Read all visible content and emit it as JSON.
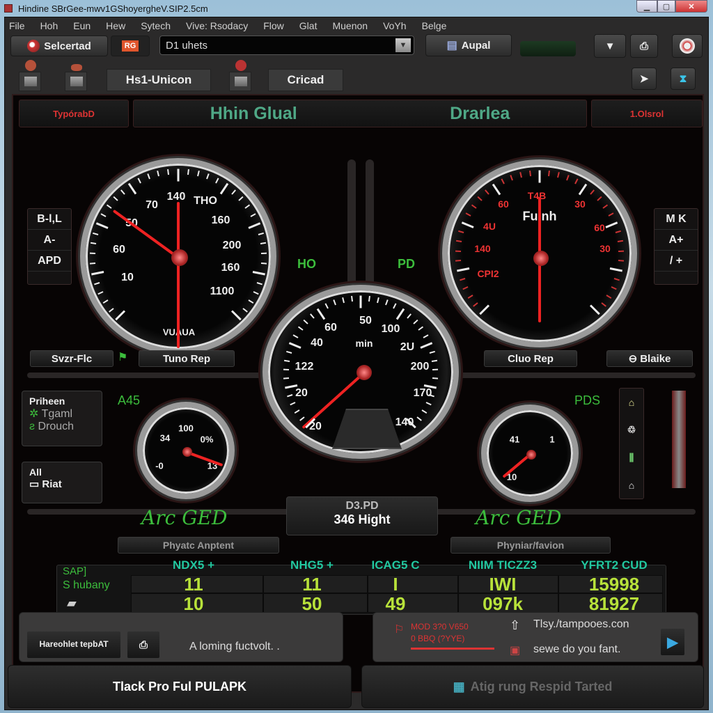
{
  "window": {
    "title": "Hindine SBrGee-mwv1GShoyergheV.SIP2.5cm",
    "controls": [
      "minimize",
      "maximize",
      "close"
    ]
  },
  "menu": [
    "File",
    "Hoh",
    "Eun",
    "Hew",
    "Sytech",
    "Vive: Rsodacy",
    "Flow",
    "Glat",
    "Muenon",
    "VoYh",
    "Belge"
  ],
  "toolbar": {
    "select_label": "Selcertad",
    "badge_label": "RG",
    "search_value": "D1 uhets",
    "apply_label": "Aupal"
  },
  "tabs": [
    {
      "label": "Hs1-Unicon"
    },
    {
      "label": "Cricad"
    }
  ],
  "header": {
    "left": "TypórabD",
    "title_left": "Hhin Glual",
    "title_right": "Drarlea",
    "right": "1.Olsrol"
  },
  "left_side_box": [
    "B-l,L",
    "A-",
    "APD"
  ],
  "right_side_box": [
    "M K",
    "A+",
    "/ +"
  ],
  "gauge_left": {
    "labels": [
      "70",
      "140",
      "THO",
      "50",
      "160",
      "60",
      "200",
      "10",
      "160",
      "1100"
    ],
    "brand": "VUAUA",
    "buttons": [
      "Svzr-Flc",
      "Tuno Rep"
    ]
  },
  "gauge_center": {
    "labels": [
      "60",
      "50",
      "100",
      "40",
      "min",
      "2U",
      "122",
      "200",
      "20",
      "170",
      "20",
      "140"
    ]
  },
  "gauge_right": {
    "labels": [
      "60",
      "T4B",
      "30",
      "4U",
      "Fuinh",
      "60",
      "140",
      "30",
      "CPI2"
    ],
    "buttons": [
      "Cluo Rep",
      "Blaike"
    ]
  },
  "indicators": {
    "left": "HO",
    "right": "PD",
    "small_left": "A45",
    "small_right": "PDS"
  },
  "small_gauge_left": {
    "labels": [
      "100",
      "34",
      "0%",
      "-0",
      "13"
    ]
  },
  "small_gauge_right": {
    "labels": [
      "41",
      "1",
      "10"
    ]
  },
  "info_left": {
    "title": "Priheen",
    "items": [
      "Tgaml",
      "Drouch"
    ]
  },
  "info_left2": {
    "title": "All",
    "item": "Riat"
  },
  "readout": {
    "label": "D3.PD",
    "value": "346 Hight"
  },
  "script_left": "Arc GED",
  "script_right": "Arc GED",
  "caption_left": "Phyatc Anptent",
  "caption_right": "Phyniar/favion",
  "table": {
    "row_labels": [
      "SAP]",
      "S hubany"
    ],
    "columns": [
      "NDX5 +",
      "NHG5 +",
      "ICAG5 C",
      "NIIM TICZZ3",
      "YFRT2 CUD"
    ],
    "rows": [
      [
        "11",
        "11",
        "I",
        "IWI",
        "15998"
      ],
      [
        "10",
        "50",
        "49",
        "097k",
        "81927"
      ]
    ]
  },
  "bottom_left": {
    "button": "Hareohlet tepbAT",
    "status": "A loming fuctvolt. ."
  },
  "bottom_right": {
    "alert_lines": [
      "MOD 3?0 V650",
      "0 BBQ (?YYE)"
    ],
    "link": "Tlsy./tampooes.con",
    "message": "sewe do you fant."
  },
  "footer_left": "Tlack Pro Ful PULAPK",
  "footer_right": "Atig rung Respid Tarted",
  "colors": {
    "accent_green": "#3cbd3c",
    "teal": "#22c8a0",
    "value_yellow": "#b8e23a",
    "alert_red": "#dd3333"
  }
}
